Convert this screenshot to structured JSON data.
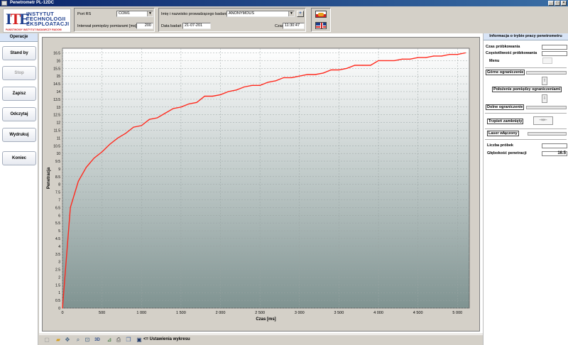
{
  "window": {
    "title": "Penetrometr PL-12DC"
  },
  "logo": {
    "line1": "INSTYTUT",
    "line2": "TECHNOLOGII",
    "line3": "EKSPLOATACJI",
    "subtitle": "PAŃSTWOWY INSTYTUT BADAWCZY  RADOM"
  },
  "settings": {
    "port_label": "Port RS",
    "port_value": "COM1",
    "interval_label": "Interwał pomiędzy pomiarami [ms]",
    "interval_value": "200",
    "operator_label": "Imię i nazwisko prowadzącego badanie",
    "operator_value": "ANONYMOUS",
    "add_label": "+",
    "date_label": "Data badań",
    "date_value": "21-07-201",
    "time_label": "Czas",
    "time_value": "11:30:47"
  },
  "operations": {
    "title": "Operacje",
    "buttons": [
      "Stand by",
      "Stop",
      "Zapisz",
      "Odczytaj",
      "Wydrukuj",
      "Koniec"
    ]
  },
  "toolbar": {
    "dim3d_label": "3D",
    "settings_label": "<= Ustawienia wykresu"
  },
  "info": {
    "title": "Informacja o trybie pracy penetrometru",
    "sampling_time": "Czas próbkowania",
    "sampling_freq": "Częstotliwość próbkowania",
    "menu": "Menu",
    "upper_limit": "Górne ograniczenie",
    "position_between": "Położenie pomiędzy ograniczeniami",
    "lower_limit": "Dolne ograniczenie",
    "clamp_closed": "Trzpień zamknięty",
    "laser_on": "Laser włączony",
    "sample_count_label": "Liczba próbek",
    "depth_label": "Głębokość penetracji",
    "depth_value": "16.5"
  },
  "colors": {
    "series": "#ff2a1e",
    "plot_top": "#ffffff",
    "plot_bottom": "#7f9391"
  },
  "chart_data": {
    "type": "line",
    "title": "",
    "xlabel": "Czas [ms]",
    "ylabel": "Penetracja",
    "xlim": [
      0,
      5150
    ],
    "ylim": [
      0,
      16.8
    ],
    "x_ticks": [
      0,
      500,
      1000,
      1500,
      2000,
      2500,
      3000,
      3500,
      4000,
      4500,
      5000
    ],
    "x_tick_labels": [
      "0",
      "500",
      "1 000",
      "1 500",
      "2 000",
      "2 500",
      "3 000",
      "3 500",
      "4 000",
      "4 500",
      "5 000"
    ],
    "y_ticks": [
      0,
      0.5,
      1,
      1.5,
      2,
      2.5,
      3,
      3.5,
      4,
      4.5,
      5,
      5.5,
      6,
      6.5,
      7,
      7.5,
      8,
      8.5,
      9,
      9.5,
      10,
      10.5,
      11,
      11.5,
      12,
      12.5,
      13,
      13.5,
      14,
      14.5,
      15,
      15.5,
      16,
      16.5
    ],
    "y_tick_labels": [
      "0",
      "0.5",
      "1",
      "1.5",
      "2",
      "2.5",
      "3",
      "3.5",
      "4",
      "4.5",
      "5",
      "5.5",
      "6",
      "6.5",
      "7",
      "7.5",
      "8",
      "8.5",
      "9",
      "9.5",
      "10",
      "10.5",
      "11",
      "11.5",
      "12",
      "12.5",
      "13",
      "13.5",
      "14",
      "14.5",
      "15",
      "15.5",
      "16",
      "16.5"
    ],
    "grid": true,
    "series": [
      {
        "x": [
          0,
          100,
          200,
          300,
          400,
          500,
          600,
          700,
          800,
          900,
          1000,
          1100,
          1200,
          1300,
          1400,
          1500,
          1600,
          1700,
          1800,
          1900,
          2000,
          2100,
          2200,
          2300,
          2400,
          2500,
          2600,
          2700,
          2800,
          2900,
          3000,
          3100,
          3200,
          3300,
          3400,
          3500,
          3600,
          3700,
          3800,
          3900,
          4000,
          4100,
          4200,
          4300,
          4400,
          4500,
          4600,
          4700,
          4800,
          4900,
          5000,
          5100
        ],
        "y": [
          0,
          6.5,
          8.2,
          9.1,
          9.7,
          10.1,
          10.6,
          11.0,
          11.3,
          11.7,
          11.8,
          12.2,
          12.3,
          12.6,
          12.9,
          13.0,
          13.2,
          13.3,
          13.7,
          13.7,
          13.8,
          14.0,
          14.1,
          14.3,
          14.4,
          14.4,
          14.6,
          14.7,
          14.9,
          14.9,
          15.0,
          15.1,
          15.1,
          15.2,
          15.4,
          15.4,
          15.5,
          15.7,
          15.7,
          15.7,
          16.0,
          16.0,
          16.0,
          16.1,
          16.1,
          16.2,
          16.2,
          16.3,
          16.3,
          16.4,
          16.4,
          16.5
        ]
      }
    ]
  }
}
